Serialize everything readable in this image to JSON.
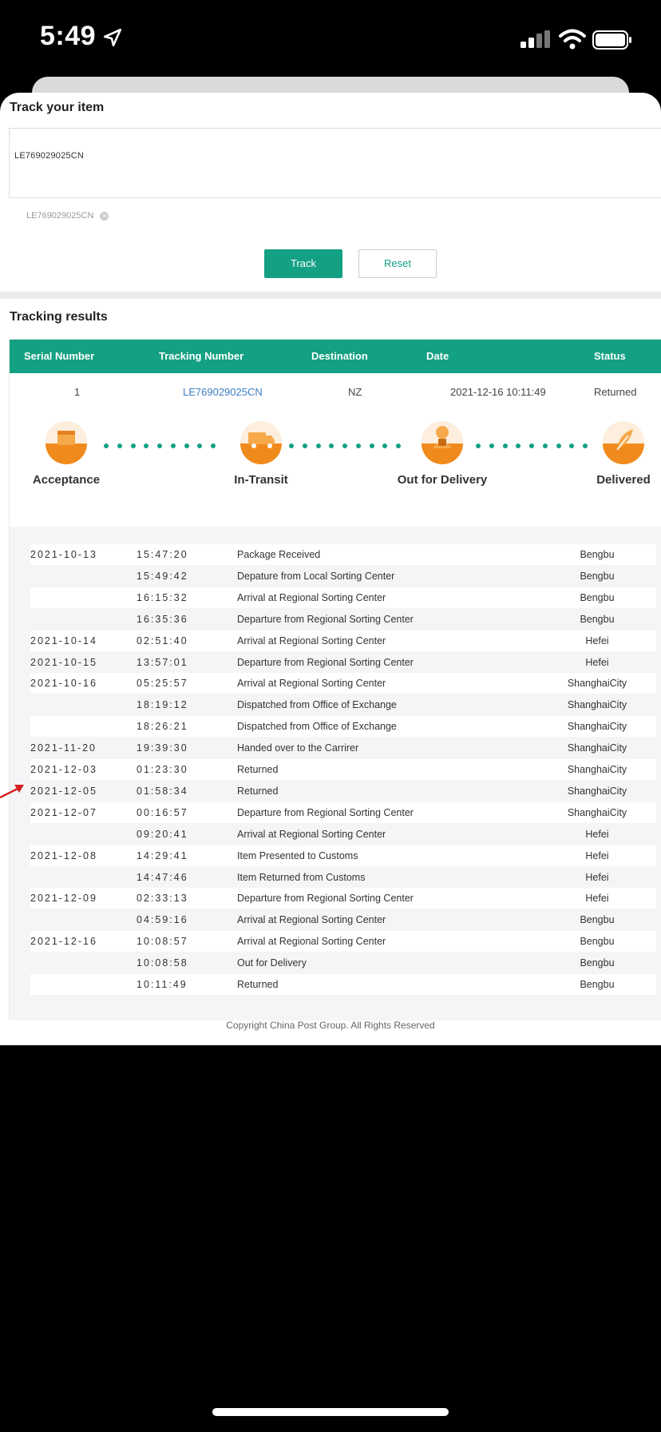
{
  "status_bar": {
    "time": "5:49"
  },
  "track": {
    "title": "Track your item",
    "input_value": "LE769029025CN",
    "chip": "LE769029025CN",
    "track_button": "Track",
    "reset_button": "Reset"
  },
  "results": {
    "title": "Tracking results",
    "columns": [
      "Serial Number",
      "Tracking Number",
      "Destination",
      "Date",
      "Status"
    ],
    "row": {
      "serial": "1",
      "tracking": "LE769029025CN",
      "destination": "NZ",
      "date": "2021-12-16 10:11:49",
      "status": "Returned"
    },
    "stages": [
      "Acceptance",
      "In-Transit",
      "Out for Delivery",
      "Delivered"
    ],
    "events": [
      {
        "date": "2021-10-13",
        "time": "15:47:20",
        "desc": "Package Received",
        "loc": "Bengbu"
      },
      {
        "date": "",
        "time": "15:49:42",
        "desc": "Depature from Local Sorting Center",
        "loc": "Bengbu"
      },
      {
        "date": "",
        "time": "16:15:32",
        "desc": "Arrival at Regional Sorting Center",
        "loc": "Bengbu"
      },
      {
        "date": "",
        "time": "16:35:36",
        "desc": "Departure from Regional Sorting Center",
        "loc": "Bengbu"
      },
      {
        "date": "2021-10-14",
        "time": "02:51:40",
        "desc": "Arrival at Regional Sorting Center",
        "loc": "Hefei"
      },
      {
        "date": "2021-10-15",
        "time": "13:57:01",
        "desc": "Departure from Regional Sorting Center",
        "loc": "Hefei"
      },
      {
        "date": "2021-10-16",
        "time": "05:25:57",
        "desc": "Arrival at Regional Sorting Center",
        "loc": "ShanghaiCity"
      },
      {
        "date": "",
        "time": "18:19:12",
        "desc": "Dispatched from Office of Exchange",
        "loc": "ShanghaiCity"
      },
      {
        "date": "",
        "time": "18:26:21",
        "desc": "Dispatched from Office of Exchange",
        "loc": "ShanghaiCity"
      },
      {
        "date": "2021-11-20",
        "time": "19:39:30",
        "desc": "Handed over to the Carrirer",
        "loc": "ShanghaiCity"
      },
      {
        "date": "2021-12-03",
        "time": "01:23:30",
        "desc": "Returned",
        "loc": "ShanghaiCity"
      },
      {
        "date": "2021-12-05",
        "time": "01:58:34",
        "desc": "Returned",
        "loc": "ShanghaiCity"
      },
      {
        "date": "2021-12-07",
        "time": "00:16:57",
        "desc": "Departure from Regional Sorting Center",
        "loc": "ShanghaiCity"
      },
      {
        "date": "",
        "time": "09:20:41",
        "desc": "Arrival at Regional Sorting Center",
        "loc": "Hefei"
      },
      {
        "date": "2021-12-08",
        "time": "14:29:41",
        "desc": "Item Presented to Customs",
        "loc": "Hefei"
      },
      {
        "date": "",
        "time": "14:47:46",
        "desc": "Item Returned from Customs",
        "loc": "Hefei"
      },
      {
        "date": "2021-12-09",
        "time": "02:33:13",
        "desc": "Departure from Regional Sorting Center",
        "loc": "Hefei"
      },
      {
        "date": "",
        "time": "04:59:16",
        "desc": "Arrival at Regional Sorting Center",
        "loc": "Bengbu"
      },
      {
        "date": "2021-12-16",
        "time": "10:08:57",
        "desc": "Arrival at Regional Sorting Center",
        "loc": "Bengbu"
      },
      {
        "date": "",
        "time": "10:08:58",
        "desc": "Out for Delivery",
        "loc": "Bengbu"
      },
      {
        "date": "",
        "time": "10:11:49",
        "desc": "Returned",
        "loc": "Bengbu"
      }
    ]
  },
  "footer": "Copyright China Post Group.  All Rights Reserved",
  "colors": {
    "accent": "#14a082",
    "link": "#3d7fc1",
    "stage_orange": "#f08a1c"
  },
  "icons": [
    "location-arrow-icon",
    "signal-icon",
    "wifi-icon",
    "battery-icon",
    "box-icon",
    "truck-icon",
    "courier-icon",
    "feather-icon",
    "close-icon",
    "red-arrow-icon"
  ]
}
